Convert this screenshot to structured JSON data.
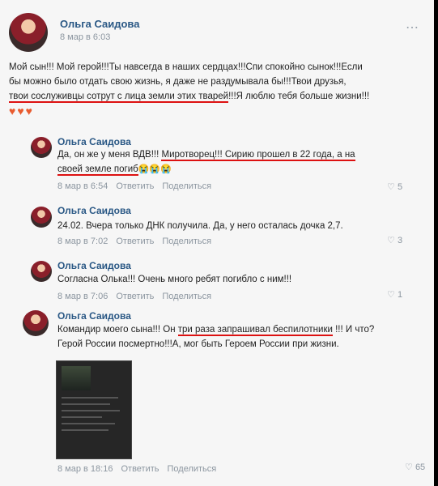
{
  "post": {
    "author": "Ольга Саидова",
    "date": "8 мар в 6:03",
    "text_a": "Мой сын!!! Мой герой!!!Ты навсегда в наших сердцах!!!Спи спокойно сынок!!!Если",
    "text_b": "бы можно было отдать свою жизнь, я даже не раздумывала бы!!!Твои друзья,",
    "text_c_underlined": "твои сослуживцы сотрут с лица земли этих тварей",
    "text_c_rest": "!!!Я люблю тебя больше жизни!!!",
    "emoji": "♥♥♥",
    "more_icon": "⋯"
  },
  "comments": [
    {
      "author": "Ольга Саидова",
      "text_a": "Да, он же у меня ВДВ!!! ",
      "text_a_u": "Миротворец!!! Сирию прошел в 22 года, а на",
      "text_b_u": "своей земле погиб",
      "text_b_emoji": "😭😭😭",
      "date": "8 мар в 6:54",
      "reply": "Ответить",
      "share": "Поделиться",
      "likes": "5"
    },
    {
      "author": "Ольга Саидова",
      "text": "24.02. Вчера только ДНК получила. Да, у него осталась дочка 2,7.",
      "date": "8 мар в 7:02",
      "reply": "Ответить",
      "share": "Поделиться",
      "likes": "3"
    },
    {
      "author": "Ольга Саидова",
      "text": "Согласна Олька!!! Очень много ребят погибло с ним!!!",
      "date": "8 мар в 7:06",
      "reply": "Ответить",
      "share": "Поделиться",
      "likes": "1"
    },
    {
      "author": "Ольга Саидова",
      "text_a": "Командир моего сына!!! Он ",
      "text_a_u": "три раза запрашивал беспилотники",
      "text_a_rest": " !!! И что?",
      "text_b": "Герой России посмертно!!!А, мог быть Героем России при жизни.",
      "date": "8 мар в 18:16",
      "reply": "Ответить",
      "share": "Поделиться",
      "likes": "65"
    }
  ],
  "like_icon": "♡"
}
